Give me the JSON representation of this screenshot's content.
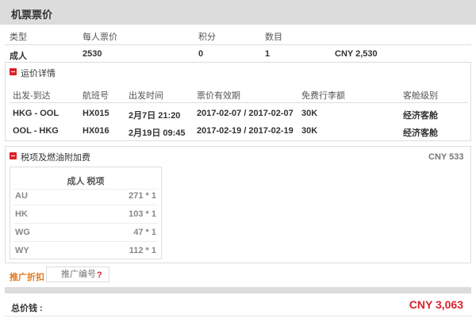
{
  "header": {
    "title": "机票票价"
  },
  "price_table": {
    "columns": [
      "类型",
      "每人票价",
      "积分",
      "数目"
    ],
    "row": {
      "type": "成人",
      "price": "2530",
      "points": "0",
      "count": "1",
      "subtotal": "CNY 2,530"
    }
  },
  "fare_details": {
    "title": "运价详情",
    "columns": [
      "出发-到达",
      "航班号",
      "出发时间",
      "票价有效期",
      "免费行李额",
      "客舱级别"
    ],
    "rows": [
      {
        "route": "HKG - OOL",
        "flight": "HX015",
        "departure": "2月7日 21:20",
        "validity": "2017-02-07 / 2017-02-07",
        "baggage": "30K",
        "cabin": "经济客舱"
      },
      {
        "route": "OOL - HKG",
        "flight": "HX016",
        "departure": "2月19日 09:45",
        "validity": "2017-02-19 / 2017-02-19",
        "baggage": "30K",
        "cabin": "经济客舱"
      }
    ]
  },
  "taxes": {
    "title": "税项及燃油附加费",
    "total": "CNY 533",
    "table_header": "成人 税项",
    "items": [
      {
        "code": "AU",
        "amount": "271 * 1"
      },
      {
        "code": "HK",
        "amount": "103 * 1"
      },
      {
        "code": "WG",
        "amount": "47 * 1"
      },
      {
        "code": "WY",
        "amount": "112 * 1"
      }
    ]
  },
  "promo": {
    "label": "推广折扣",
    "placeholder": "推广编号",
    "help": "?"
  },
  "total": {
    "label": "总价钱 :",
    "amount": "CNY 3,063"
  },
  "colors": {
    "accent_red": "#d9232b",
    "promo_orange": "#e07a1a",
    "header_gray": "#dcdcdc"
  }
}
